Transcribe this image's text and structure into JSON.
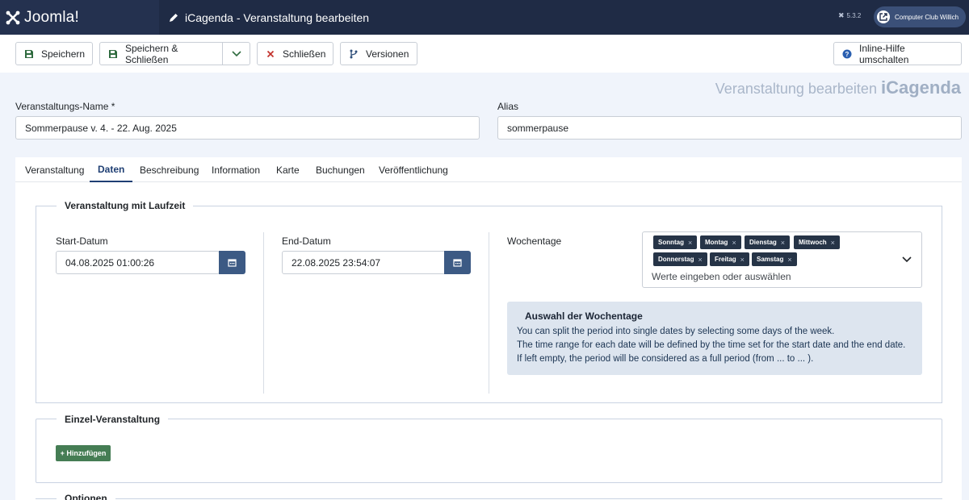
{
  "header": {
    "brand": "Joomla!",
    "title": "iCagenda - Veranstaltung bearbeiten",
    "version": "5.3.2",
    "site_button": "Computer Club Willich"
  },
  "toolbar": {
    "save": "Speichern",
    "save_close": "Speichern & Schließen",
    "close": "Schließen",
    "versions": "Versionen",
    "help": "Inline-Hilfe umschalten"
  },
  "component_heading": {
    "prefix": "Veranstaltung bearbeiten",
    "name": "iCagenda"
  },
  "form": {
    "name_label": "Veranstaltungs-Name *",
    "name_value": "Sommerpause v. 4. - 22. Aug. 2025",
    "alias_label": "Alias",
    "alias_value": "sommerpause"
  },
  "tabs": [
    {
      "label": "Veranstaltung",
      "active": false
    },
    {
      "label": "Daten",
      "active": true
    },
    {
      "label": "Beschreibung",
      "active": false
    },
    {
      "label": "Information",
      "active": false
    },
    {
      "label": "Karte",
      "active": false
    },
    {
      "label": "Buchungen",
      "active": false
    },
    {
      "label": "Veröffentlichung",
      "active": false
    }
  ],
  "period": {
    "legend": "Veranstaltung mit Laufzeit",
    "start_label": "Start-Datum",
    "start_value": "04.08.2025 01:00:26",
    "end_label": "End-Datum",
    "end_value": "22.08.2025 23:54:07",
    "weekdays_label": "Wochentage",
    "weekdays": [
      "Sonntag",
      "Montag",
      "Dienstag",
      "Mittwoch",
      "Donnerstag",
      "Freitag",
      "Samstag"
    ],
    "weekdays_placeholder": "Werte eingeben oder auswählen",
    "info_title": "Auswahl der Wochentage",
    "info_lines": [
      "You can split the period into single dates by selecting some days of the week.",
      "The time range for each date will be defined by the time set for the start date and the end date.",
      "If left empty, the period will be considered as a full period (from ... to ... )."
    ]
  },
  "single": {
    "legend": "Einzel-Veranstaltung",
    "add_button": "+ Hinzufügen"
  },
  "options": {
    "legend": "Optionen"
  },
  "colors": {
    "header_bg": "#1f2b45",
    "accent": "#3c5a84",
    "add_button": "#457d54",
    "chip_bg": "#263447"
  }
}
